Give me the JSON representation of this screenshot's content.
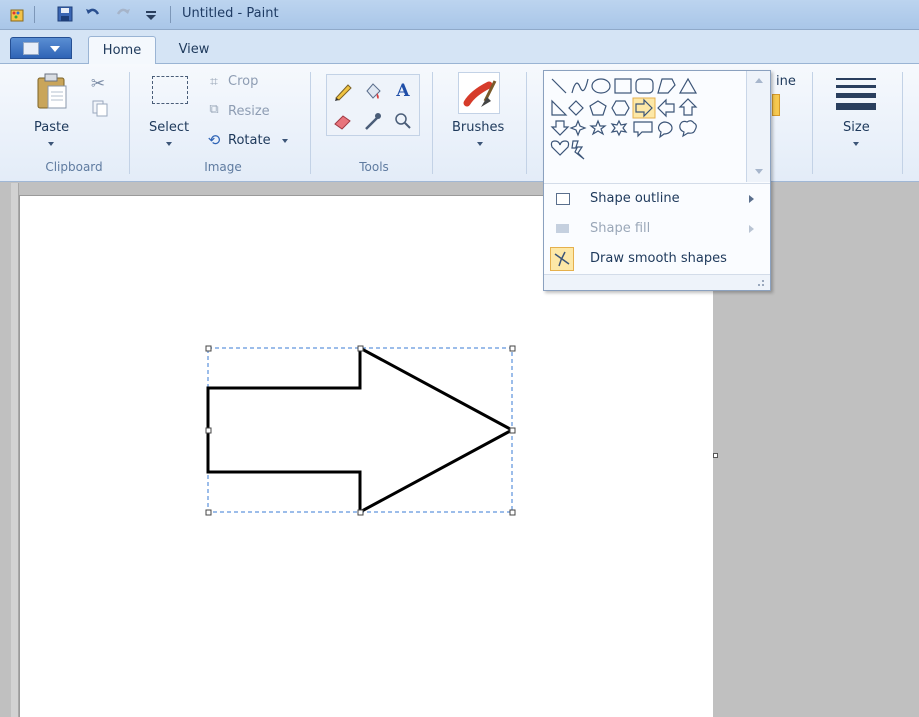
{
  "window": {
    "title": "Untitled - Paint"
  },
  "tabs": [
    {
      "label": "Home",
      "active": true
    },
    {
      "label": "View",
      "active": false
    }
  ],
  "ribbon": {
    "clipboard": {
      "paste_label": "Paste",
      "group_label": "Clipboard"
    },
    "image": {
      "select_label": "Select",
      "crop_label": "Crop",
      "resize_label": "Resize",
      "rotate_label": "Rotate",
      "group_label": "Image"
    },
    "tools": {
      "group_label": "Tools",
      "text_tool_glyph": "A"
    },
    "brushes_label": "Brushes",
    "outline_partial_label": "ine",
    "size_label": "Size"
  },
  "shapes_dropdown": {
    "selected_shape": "right-arrow",
    "menu_items": [
      {
        "label": "Shape outline",
        "enabled": true,
        "has_submenu": true
      },
      {
        "label": "Shape fill",
        "enabled": false,
        "has_submenu": true
      },
      {
        "label": "Draw smooth shapes",
        "enabled": true,
        "has_submenu": false,
        "checked": true
      }
    ]
  },
  "colors": {
    "accent_blue": "#2f64b6",
    "ribbon_bg": "#e3ecf8",
    "canvas_bg": "#ffffff",
    "selection_highlight": "#fde8a7"
  }
}
